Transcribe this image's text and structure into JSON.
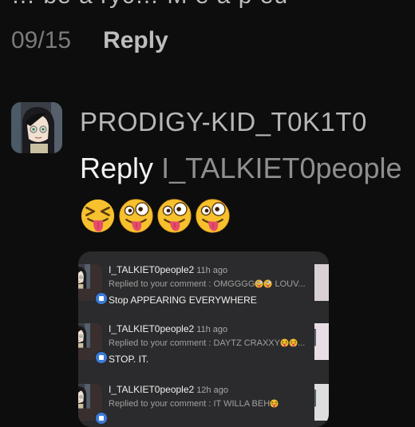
{
  "top": {
    "cutoff_text": "… be a ryc… M e a p  eu",
    "date": "09/15",
    "reply_label": "Reply"
  },
  "comment": {
    "username": "PRODIGY-KID_T0K1T0",
    "reply_word": "Reply",
    "reply_target": "I_TALKIET0people",
    "emojis": [
      "zany-face-icon",
      "zany-face-icon",
      "zany-face-icon",
      "zany-face-icon"
    ]
  },
  "screenshot": {
    "items": [
      {
        "user": "I_TALKIET0people2",
        "time": "11h ago",
        "subtitle": "Replied to your comment : OMGGGG",
        "subtitle_suffix": " LOUV...",
        "message": "Stop APPEARING EVERYWHERE"
      },
      {
        "user": "I_TALKIET0people2",
        "time": "11h ago",
        "subtitle": "Replied to your comment : DAYTZ CRAXXY",
        "subtitle_suffix": "...",
        "message": "STOP. IT."
      },
      {
        "user": "I_TALKIET0people2",
        "time": "12h ago",
        "subtitle": "Replied to your comment : IT WILLA BEH",
        "subtitle_suffix": "",
        "message": ""
      }
    ]
  },
  "colors": {
    "background": "#0d0d0d",
    "card": "#2b2b2d",
    "badge": "#3b7bd8",
    "emoji_face": "#f7c12e",
    "tongue": "#e64b6b"
  }
}
